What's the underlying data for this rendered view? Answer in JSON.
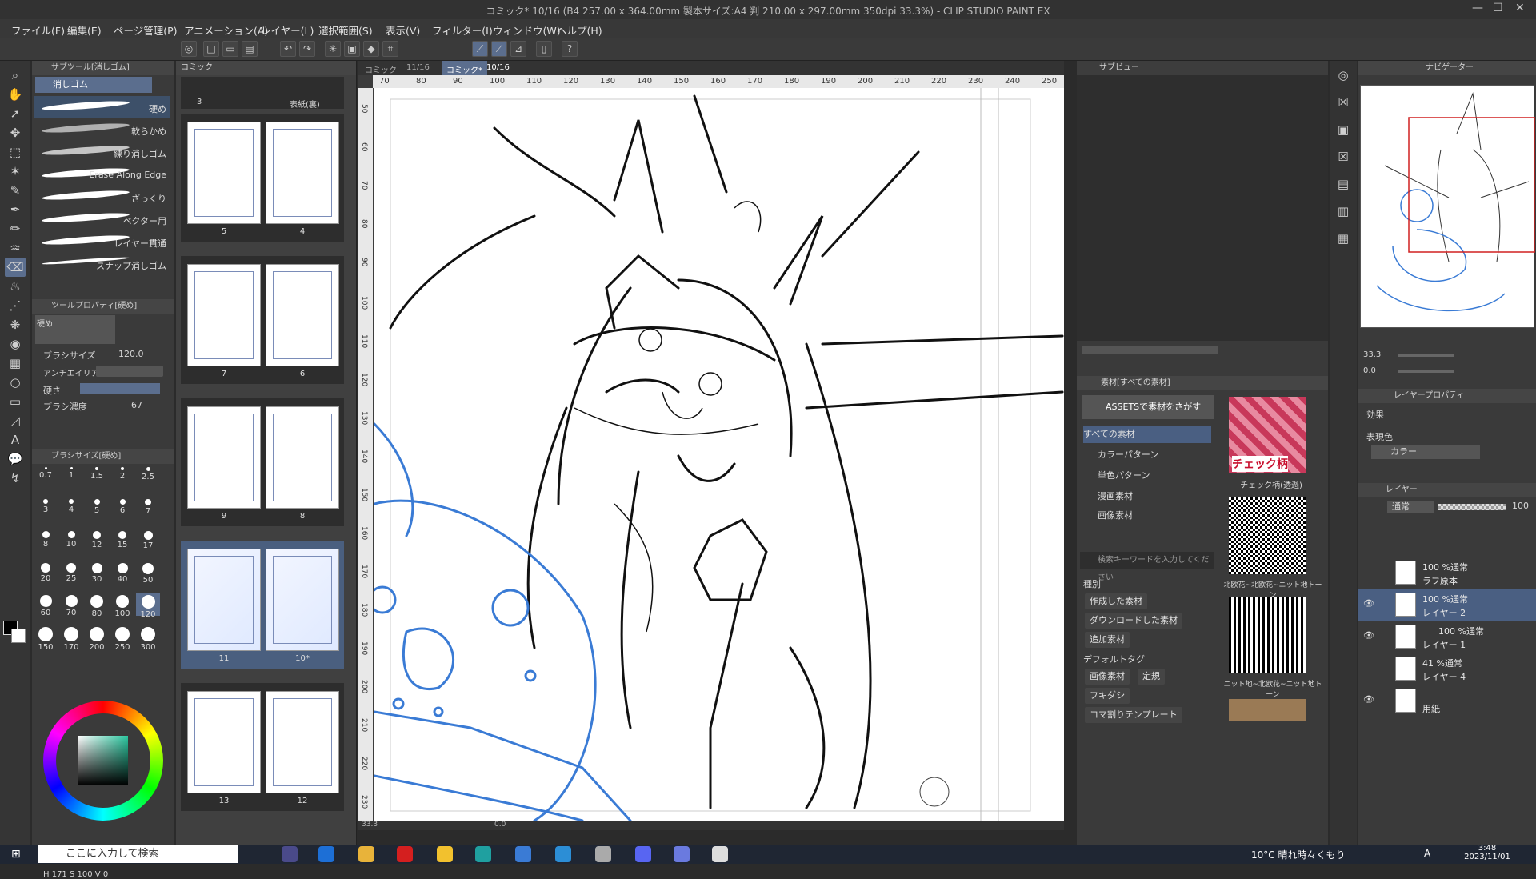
{
  "window": {
    "title": "コミック* 10/16 (B4 257.00 x 364.00mm 製本サイズ:A4 判 210.00 x 297.00mm 350dpi 33.3%) - CLIP STUDIO PAINT EX",
    "min": "—",
    "max": "☐",
    "close": "✕"
  },
  "menu": [
    "ファイル(F)",
    "編集(E)",
    "ページ管理(P)",
    "アニメーション(A)",
    "レイヤー(L)",
    "選択範囲(S)",
    "表示(V)",
    "フィルター(I)",
    "ウィンドウ(W)",
    "ヘルプ(H)"
  ],
  "subtool": {
    "header": "サブツール[消しゴム]",
    "group": "消しゴム",
    "brushes": [
      "硬め",
      "軟らかめ",
      "練り消しゴム",
      "Erase Along Edge",
      "ざっくり",
      "ベクター用",
      "レイヤー貫通",
      "スナップ消しゴム"
    ],
    "prop_header": "ツールプロパティ[硬め]",
    "prop_title": "硬め",
    "brush_size_label": "ブラシサイズ",
    "brush_size_value": "120.0",
    "anti_label": "アンチエイリアス",
    "hardness_label": "硬さ",
    "density_label": "ブラシ濃度",
    "density_value": "67",
    "size_header": "ブラシサイズ[硬め]",
    "sizes": [
      "0.7",
      "1",
      "1.5",
      "2",
      "2.5",
      "3",
      "4",
      "5",
      "6",
      "7",
      "8",
      "10",
      "12",
      "15",
      "17",
      "20",
      "25",
      "30",
      "40",
      "50",
      "60",
      "70",
      "80",
      "100",
      "120",
      "150",
      "170",
      "200",
      "250",
      "300"
    ],
    "color_values": "171",
    "color_values2": "100",
    "color_values3": "0"
  },
  "pages": {
    "panel_label": "コミック",
    "top_labels": [
      "3",
      "表紙(裏)"
    ],
    "spreads": [
      [
        "5",
        "4"
      ],
      [
        "7",
        "6"
      ],
      [
        "9",
        "8"
      ],
      [
        "11",
        "10*"
      ],
      [
        "13",
        "12"
      ]
    ]
  },
  "tabs": [
    "コミック",
    "11/16",
    "コミック*",
    "10/16"
  ],
  "ruler_h": [
    "70",
    "80",
    "90",
    "100",
    "110",
    "120",
    "130",
    "140",
    "150",
    "160",
    "170",
    "180",
    "190",
    "200",
    "210",
    "220",
    "230",
    "240",
    "250"
  ],
  "ruler_v": [
    "50",
    "60",
    "70",
    "80",
    "90",
    "100",
    "110",
    "120",
    "130",
    "140",
    "150",
    "160",
    "170",
    "180",
    "190",
    "200",
    "210",
    "220",
    "230"
  ],
  "status": {
    "zoom": "33.3",
    "coord": "0.0"
  },
  "subview_label": "サブビュー",
  "material": {
    "header": "素材[すべての素材]",
    "assets_btn": "ASSETSで素材をさがす",
    "tree": [
      "すべての素材",
      "カラーパターン",
      "単色パターン",
      "漫画素材",
      "画像素材"
    ],
    "search_placeholder": "検索キーワードを入力してください",
    "type_label": "種別",
    "types": [
      "作成した素材",
      "ダウンロードした素材",
      "追加素材"
    ],
    "default_tag": "デフォルトタグ",
    "tags": [
      "画像素材",
      "定規",
      "フキダシ",
      "コマ割りテンプレート"
    ],
    "thumbs": [
      "チェック柄(透過)",
      "北欧花~北欧花~ニット地トーン",
      "ニット地~北欧花~ニット地トーン"
    ],
    "check_text": "チェック柄"
  },
  "navigator": {
    "label": "ナビゲーター",
    "zoom": "33.3",
    "angle": "0.0"
  },
  "layerprop": {
    "label": "レイヤープロパティ",
    "effect": "効果",
    "expression": "表現色",
    "color_mode": "カラー"
  },
  "layers": {
    "label": "レイヤー",
    "blend": "通常",
    "opacity": "100",
    "items": [
      {
        "pct": "100 %通常",
        "name": "ラフ原本"
      },
      {
        "pct": "100 %通常",
        "name": "レイヤー 2"
      },
      {
        "pct": "100 %通常",
        "name": "レイヤー 1"
      },
      {
        "pct": "41 %通常",
        "name": "レイヤー 4"
      },
      {
        "pct": "",
        "name": "用紙"
      }
    ]
  },
  "taskbar": {
    "search": "ここに入力して検索",
    "weather": "10°C 晴れ時々くもり",
    "time": "3:48",
    "date": "2023/11/01",
    "ime": "A"
  },
  "colors": {
    "accent": "#5b6e8e",
    "sketch_blue": "#3a7bd5"
  }
}
